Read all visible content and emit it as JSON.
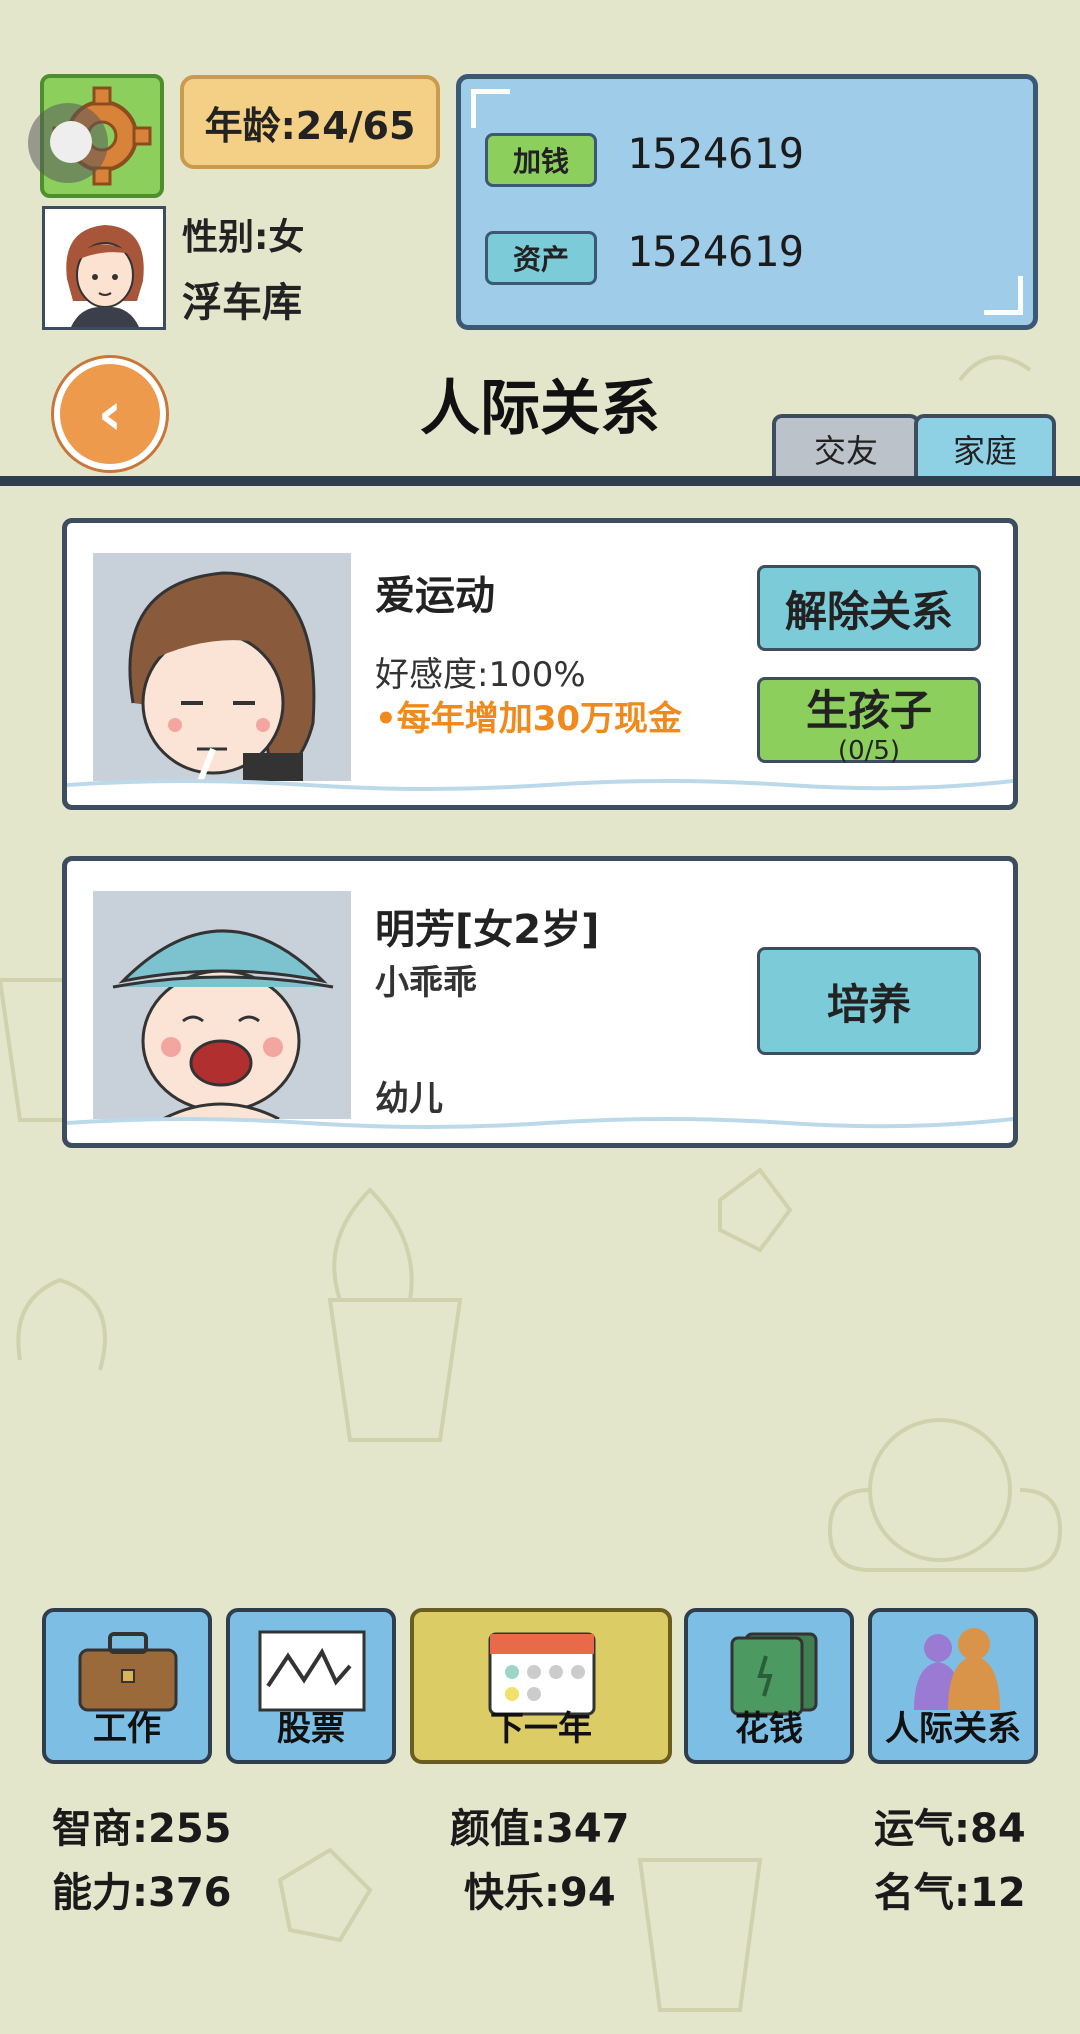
{
  "header": {
    "age_label": "年龄:24/65",
    "gender_label": "性别:女",
    "player_name": "浮车库"
  },
  "money_panel": {
    "add_money_label": "加钱",
    "add_money_value": "1524619",
    "assets_label": "资产",
    "assets_value": "1524619"
  },
  "page": {
    "title": "人际关系",
    "tabs": [
      {
        "label": "交友",
        "active": false
      },
      {
        "label": "家庭",
        "active": true
      }
    ]
  },
  "cards": [
    {
      "name": "爱运动",
      "line1": "好感度:100%",
      "line2": "•每年增加30万现金",
      "buttons": [
        {
          "label": "解除关系"
        },
        {
          "label": "生孩子",
          "sub": "(0/5)"
        }
      ]
    },
    {
      "name": "明芳[女2岁]",
      "line1": "小乖乖",
      "line2": "幼儿",
      "buttons": [
        {
          "label": "培养"
        }
      ]
    }
  ],
  "nav": [
    {
      "label": "工作",
      "icon": "briefcase-icon"
    },
    {
      "label": "股票",
      "icon": "stock-chart-icon"
    },
    {
      "label": "下一年",
      "icon": "calendar-icon"
    },
    {
      "label": "花钱",
      "icon": "cash-icon"
    },
    {
      "label": "人际关系",
      "icon": "people-icon"
    }
  ],
  "stats": {
    "iq": "智商:255",
    "looks": "颜值:347",
    "luck": "运气:84",
    "ability": "能力:376",
    "happiness": "快乐:94",
    "fame": "名气:12"
  },
  "colors": {
    "background": "#e4e6cc",
    "panel_blue": "#9fcce8",
    "button_green": "#8ccf5d",
    "button_teal": "#7ccbd8",
    "accent_orange": "#f08a1c",
    "outline": "#3c4d5f"
  }
}
